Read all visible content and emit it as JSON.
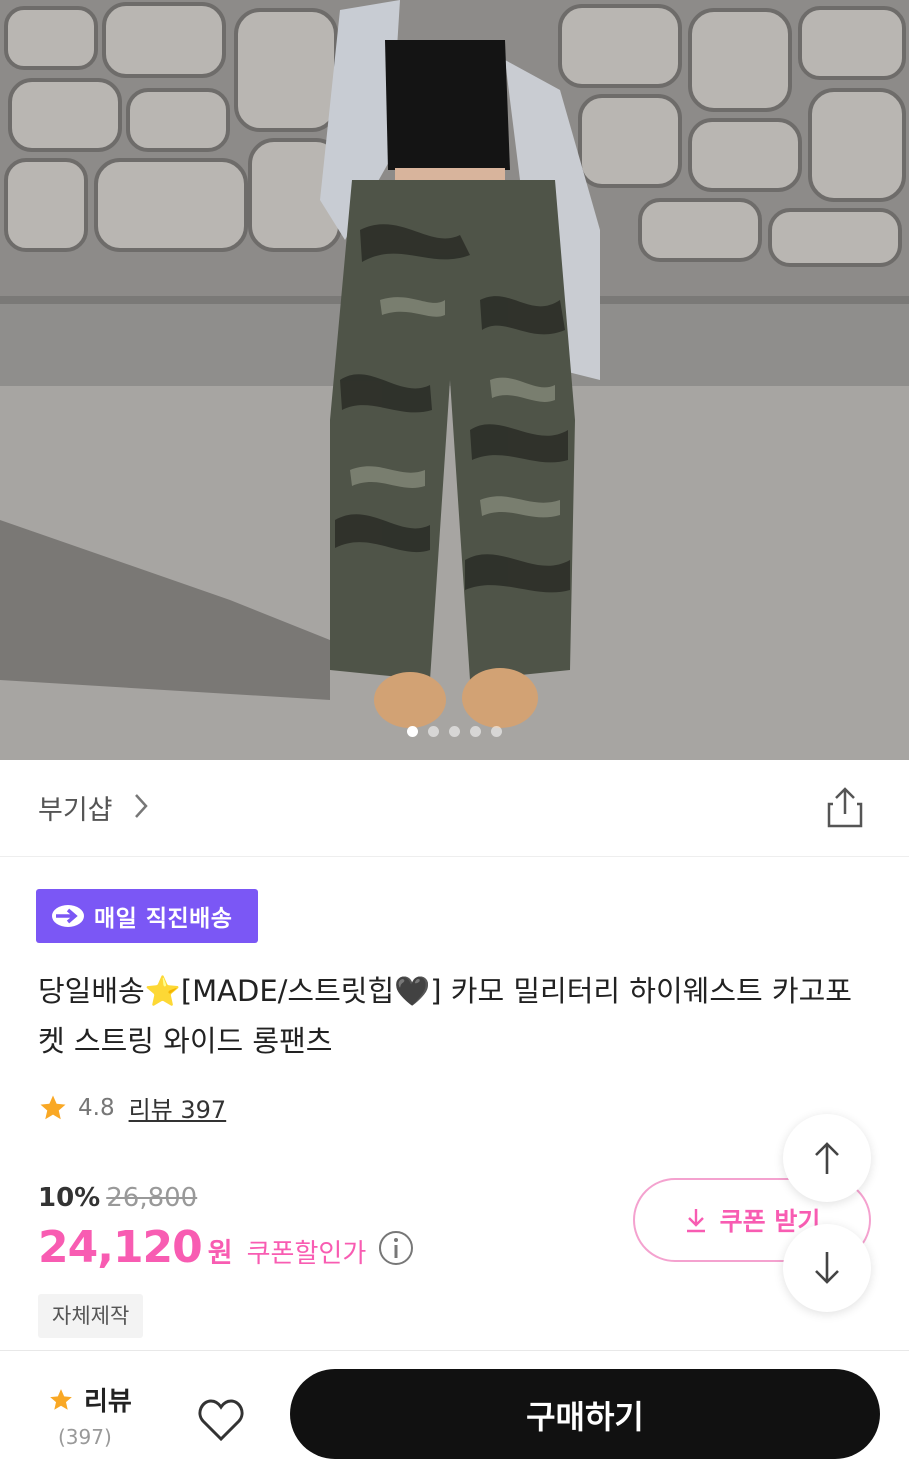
{
  "image": {
    "alt": "product photo",
    "indicator_count": 5,
    "active_index": 0
  },
  "shop": {
    "name": "부기샵"
  },
  "badge": {
    "label": "매일 직진배송"
  },
  "product": {
    "title": "당일배송⭐[MADE/스트릿힙🖤] 카모 밀리터리 하이웨스트 카고포켓 스트링 와이드 롱팬츠"
  },
  "rating": {
    "score": "4.8",
    "reviews_label": "리뷰 397"
  },
  "price": {
    "discount": "10%",
    "original": "26,800",
    "sale": "24,120",
    "currency": "원",
    "coupon_label": "쿠폰할인가"
  },
  "coupon_button": {
    "label": "쿠폰 받기"
  },
  "tag": "자체제작",
  "bottom": {
    "review_label": "리뷰",
    "review_count": "(397)",
    "buy_label": "구매하기"
  },
  "colors": {
    "accent_pink": "#f85cb2",
    "badge_purple": "#7b57f5",
    "star": "#f9a825"
  }
}
